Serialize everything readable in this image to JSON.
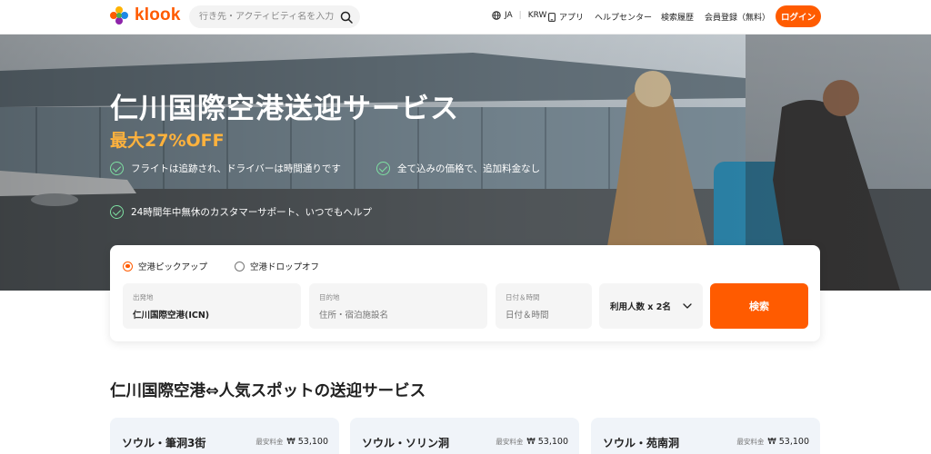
{
  "brand": {
    "name": "klook",
    "accent": "#ff5b00"
  },
  "header": {
    "search_placeholder": "行き先・アクティビティ名を入力",
    "lang": "JA",
    "currency": "KRW",
    "app": "アプリ",
    "help": "ヘルプセンター",
    "history": "検索履歴",
    "signup": "会員登録（無料）",
    "login": "ログイン"
  },
  "hero": {
    "title": "仁川国際空港送迎サービス",
    "discount": "最大27%OFF",
    "features": [
      "フライトは追跡され、ドライバーは時間通りです",
      "全て込みの価格で、追加料金なし",
      "24時間年中無休のカスタマーサポート、いつでもヘルプ"
    ]
  },
  "booking": {
    "modes": [
      "空港ピックアップ",
      "空港ドロップオフ"
    ],
    "selected_mode": "空港ピックアップ",
    "from": {
      "label": "出発地",
      "value": "仁川国際空港(ICN)"
    },
    "to": {
      "label": "目的地",
      "placeholder": "住所・宿泊施設名"
    },
    "datetime": {
      "label": "日付＆時間",
      "placeholder": "日付＆時間"
    },
    "passengers": "利用人数 x 2名",
    "search": "検索"
  },
  "section": {
    "title": "仁川国際空港⇔人気スポットの送迎サービス",
    "cards": [
      {
        "name": "ソウル・筆洞3街",
        "price_label": "最安料金",
        "price": "₩ 53,100"
      },
      {
        "name": "ソウル・ソリン洞",
        "price_label": "最安料金",
        "price": "₩ 53,100"
      },
      {
        "name": "ソウル・苑南洞",
        "price_label": "最安料金",
        "price": "₩ 53,100"
      }
    ]
  }
}
